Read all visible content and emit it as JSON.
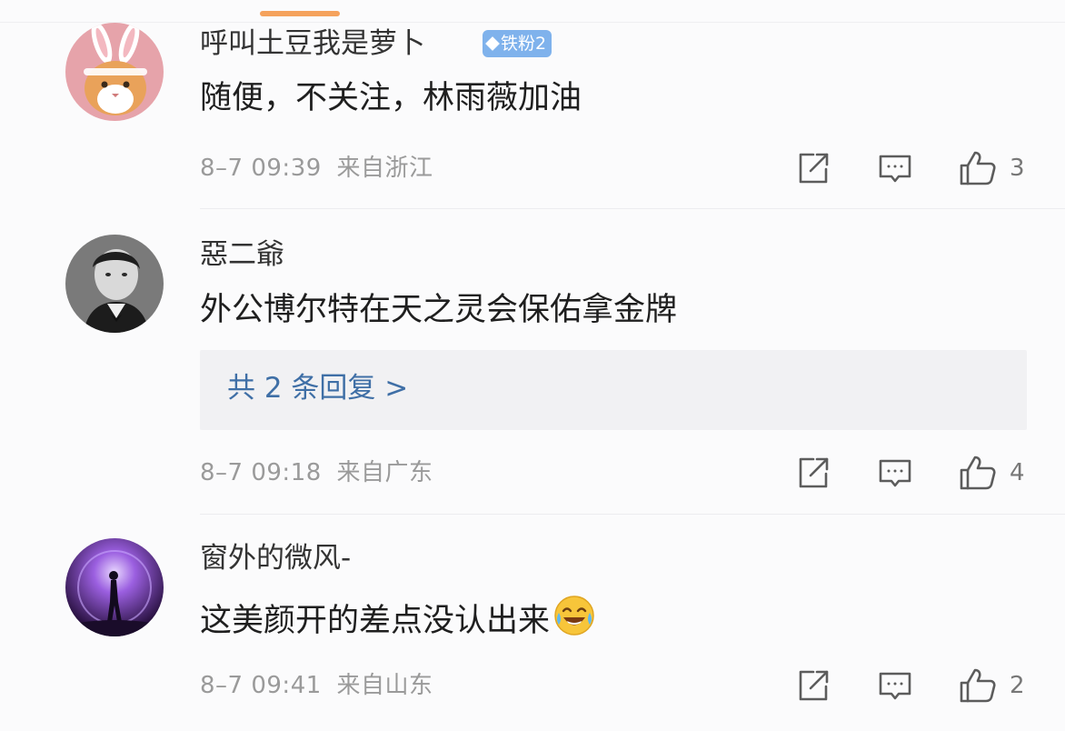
{
  "comments": [
    {
      "username": "呼叫土豆我是萝卜",
      "badge": "铁粉2",
      "content": "随便，不关注，林雨薇加油",
      "time": "8–7 09:39",
      "location": "来自浙江",
      "likes": "3",
      "avatar_icon": "bunny-cat-avatar"
    },
    {
      "username": "惡二爺",
      "content": "外公博尔特在天之灵会保佑拿金牌",
      "reply_text": "共 2 条回复 >",
      "time": "8–7 09:18",
      "location": "来自广东",
      "likes": "4",
      "avatar_icon": "portrait-avatar"
    },
    {
      "username": "窗外的微风-",
      "content": "这美颜开的差点没认出来",
      "emoji": "laugh-cry-emoji",
      "time": "8–7 09:41",
      "location": "来自山东",
      "likes": "2",
      "avatar_icon": "concert-avatar"
    }
  ],
  "colors": {
    "accent_tab": "#f5a25c",
    "badge_bg": "#7fb2ec",
    "reply_link": "#3f6fa6",
    "meta_text": "#9a9a9a"
  }
}
